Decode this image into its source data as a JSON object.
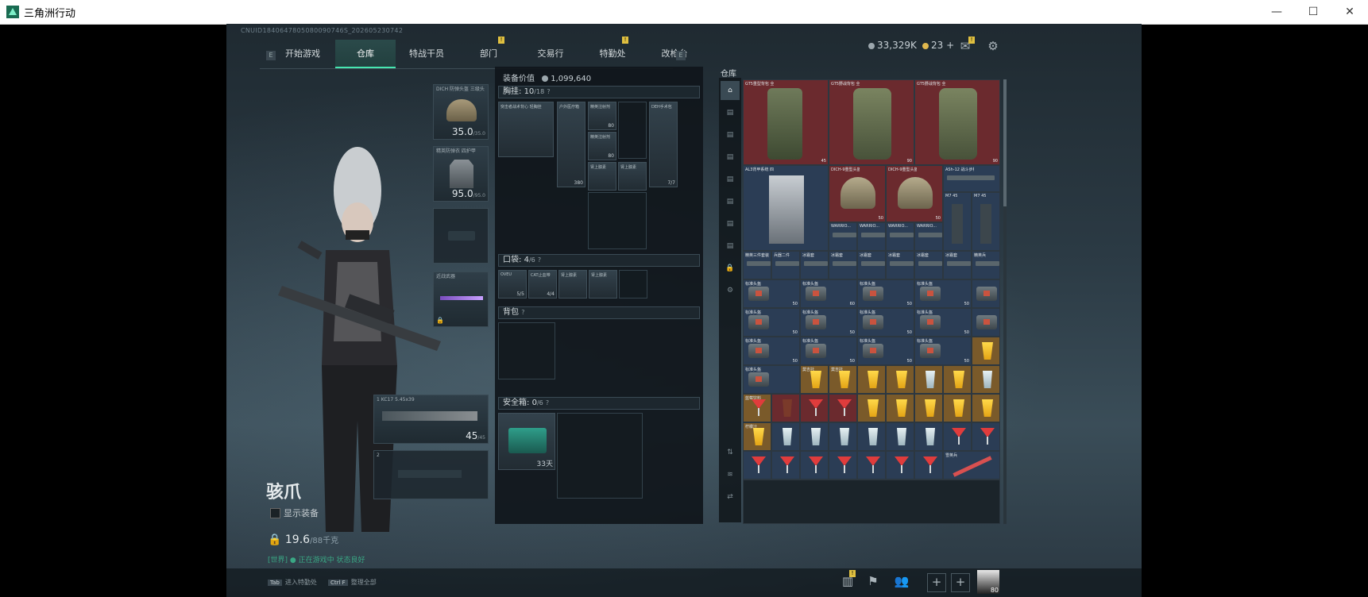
{
  "window": {
    "title": "三角洲行动",
    "minimize": "—",
    "maximize": "☐",
    "close": "✕"
  },
  "header": {
    "uid": "CNUID1840647805080090746S_202605230742",
    "tabs": [
      {
        "label": "开始游戏"
      },
      {
        "label": "仓库"
      },
      {
        "label": "特战干员"
      },
      {
        "label": "部门",
        "badge": "!"
      },
      {
        "label": "交易行"
      },
      {
        "label": "特勤处",
        "badge": "!"
      },
      {
        "label": "改枪台"
      }
    ],
    "left_key": "E",
    "right_key": "E",
    "currency_silver": "33,329K",
    "currency_gold": "23",
    "plus": "+",
    "mail_badge": "!"
  },
  "character": {
    "name": "骇爪",
    "show_gear_label": "显示装备",
    "weight": "19.6",
    "weight_max": "/88千克",
    "status": "[世界] ● 正在游戏中  状态良好"
  },
  "equipment": {
    "helmet": {
      "label": "DICH 防弹头盔 三级头",
      "value": "35.0",
      "max": "/35.0"
    },
    "armor": {
      "label": "精英防弹衣 四护甲",
      "value": "95.0",
      "max": "/95.0"
    },
    "melee_label": "近战武器",
    "primary": {
      "label": "KC17 5.45x39",
      "ammo": "45",
      "ammo_max": "/45",
      "slot": "1"
    },
    "secondary_slot": "2"
  },
  "loadout": {
    "value_label": "装备价值",
    "value": "1,099,640",
    "chest": {
      "label": "胸挂:",
      "count": "10",
      "cap": "/18"
    },
    "chest_items": [
      {
        "name": "突击者战术背心 轻胸挂"
      },
      {
        "name": "户外医疗箱",
        "count": "380"
      },
      {
        "name": "精英注射剂",
        "count": "80"
      },
      {
        "name": "精英注射剂",
        "count": "80"
      },
      {
        "name": "DEH手术包",
        "count": "7/7"
      },
      {
        "name": "肾上腺素"
      },
      {
        "name": "肾上腺素"
      }
    ],
    "pocket": {
      "label": "口袋:",
      "count": "4",
      "cap": "/6"
    },
    "pocket_items": [
      {
        "name": "OVEU",
        "count": "5/5"
      },
      {
        "name": "CAT止血带",
        "count": "4/4"
      },
      {
        "name": "肾上腺素"
      },
      {
        "name": "肾上腺素"
      }
    ],
    "backpack": {
      "label": "背包"
    },
    "safebox": {
      "label": "安全箱:",
      "count": "0",
      "cap": "/6",
      "timer": "33天"
    }
  },
  "stash": {
    "title": "仓库",
    "rows": [
      {
        "cells": [
          "GT5重型背包 全视力量",
          "GT5野战背包 全视力量",
          "GT5野战背包 全视力量"
        ]
      },
      {
        "cells": [
          "AL3背甲系统 四护甲",
          "DICH-9重型头盔 三级头",
          "DICH-9重型头盔 三级头",
          "ASh-12 战斗步枪",
          "M7 45",
          "M7 45"
        ]
      }
    ],
    "small_labels": [
      "WARRIO...",
      "WARRIO...",
      "WARRIO...",
      "WARRIO..."
    ],
    "case_label": "标准头盔",
    "gun_labels": [
      "精英三件套装",
      "兵器二件",
      "冰霜套",
      "冰霜套",
      "冰霜套",
      "冰霜套",
      "冰霜套",
      "冰霜套",
      "精英兵",
      "雪英兵"
    ],
    "drink_labels": [
      "莫吉托",
      "莫吉托",
      "蓝莓饮料",
      "鸡尾酒",
      "鸡尾酒",
      "柠檬汁",
      "柠檬汁",
      "柠檬汁",
      "柠檬汁"
    ],
    "num_50": "50",
    "num_45": "45",
    "num_90": "90",
    "num_60": "60"
  },
  "bottom": {
    "hint1_key": "Tab",
    "hint1": "进入特勤处",
    "hint2_key": "Ctrl F",
    "hint2": "整理全部",
    "level": "80",
    "badge": "!"
  },
  "colors": {
    "accent": "#47e6b0",
    "stash_red": "#6b2a2e",
    "stash_blue": "#2b3d55",
    "stash_gold": "#7a5a2a",
    "stash_olive": "#3e4a3a"
  }
}
